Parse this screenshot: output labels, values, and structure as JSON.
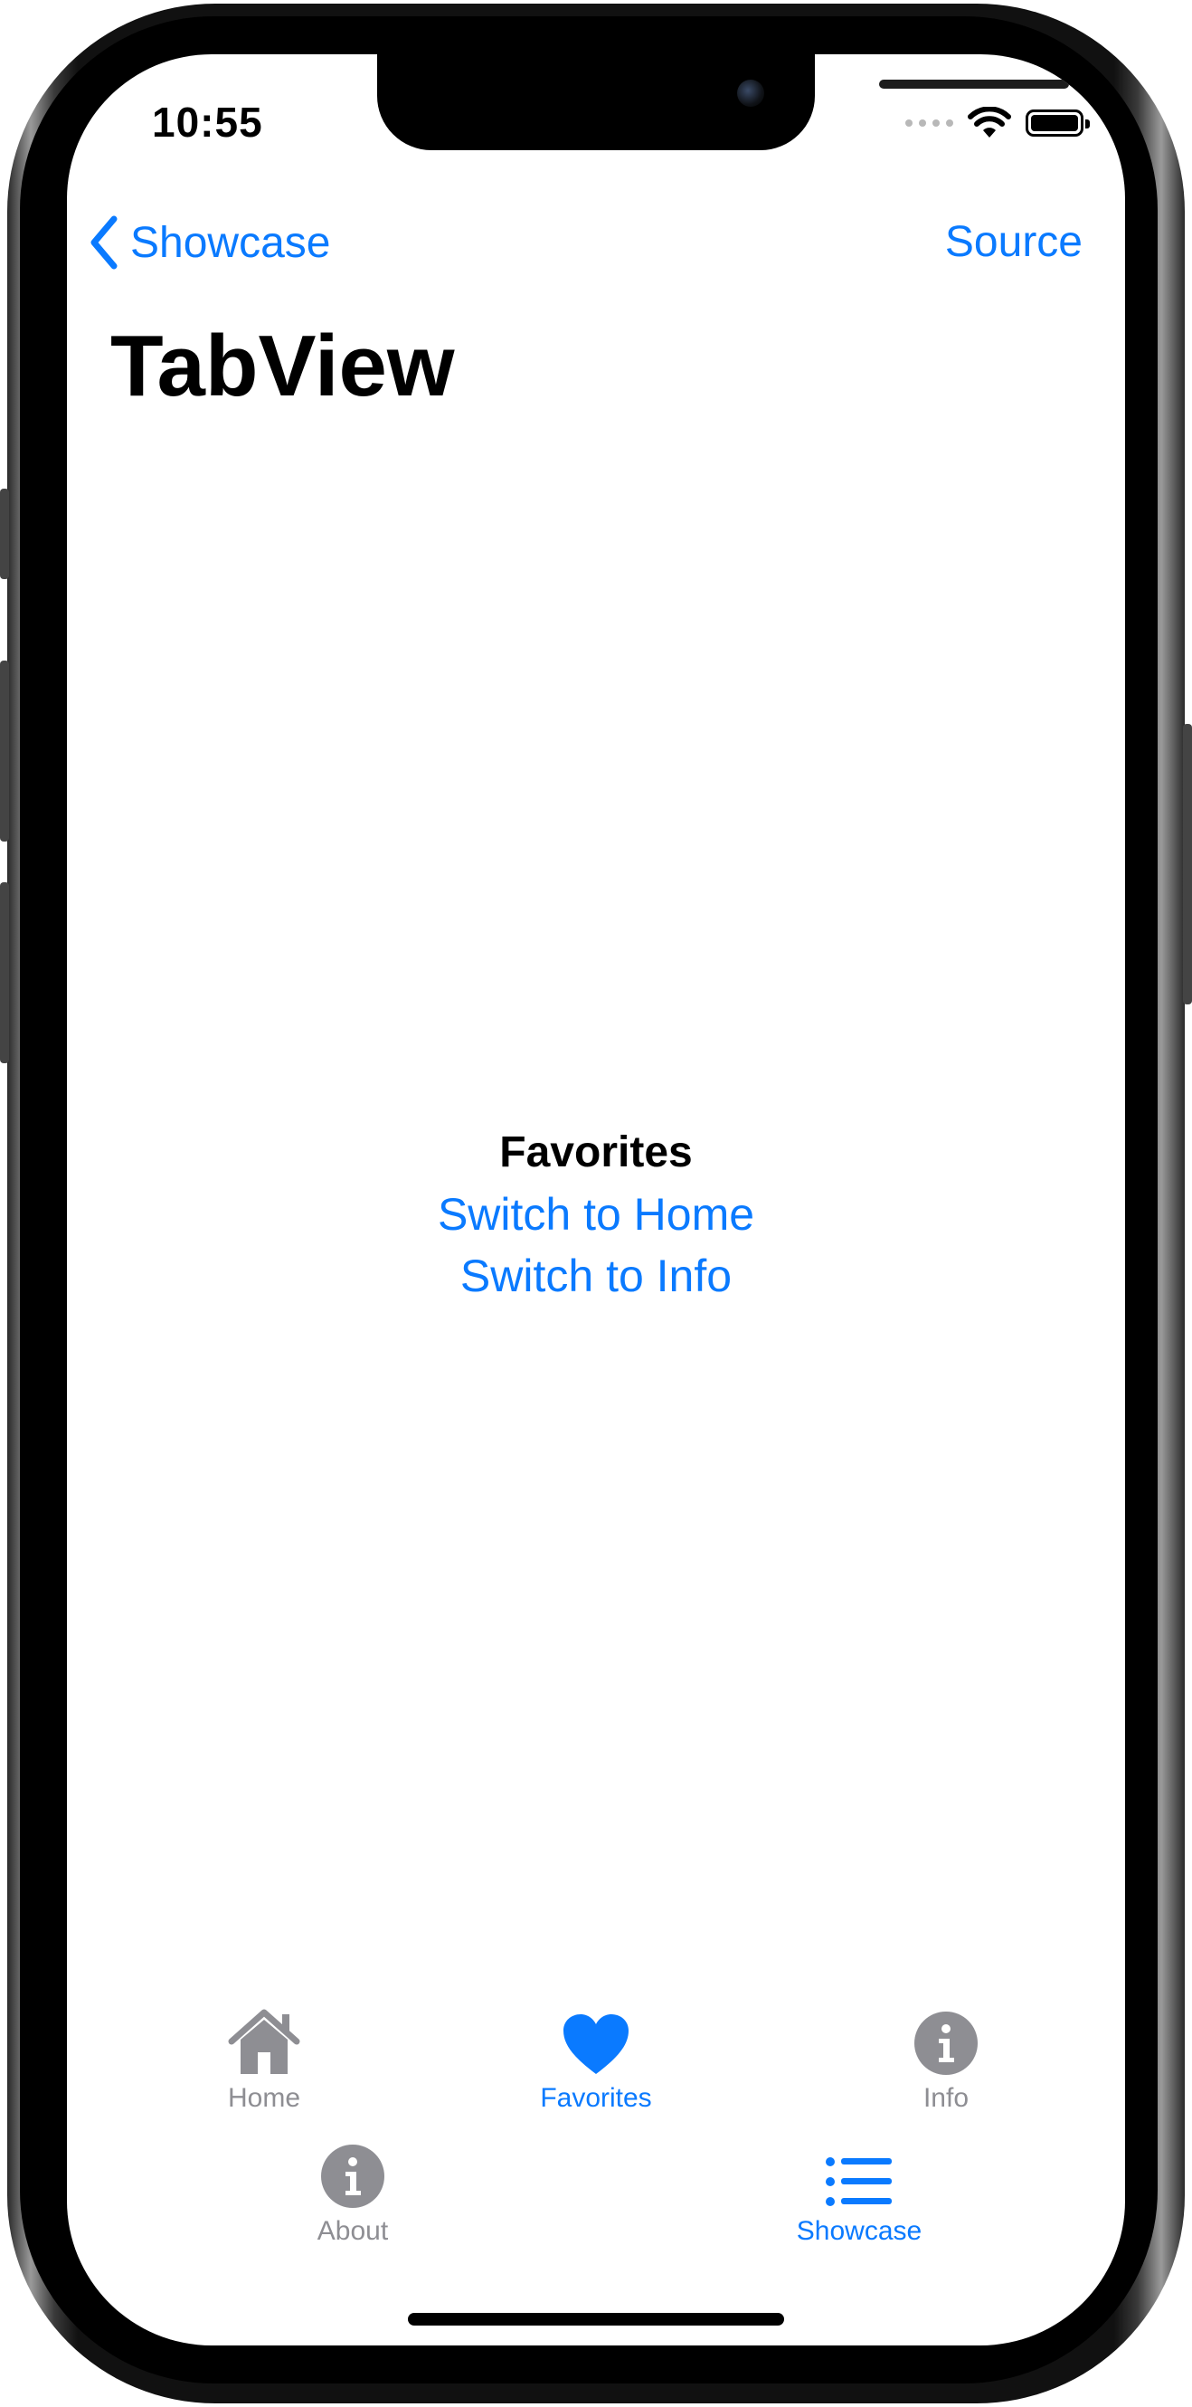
{
  "status_bar": {
    "time": "10:55"
  },
  "nav": {
    "back_label": "Showcase",
    "right_button": "Source",
    "title": "TabView"
  },
  "content": {
    "heading": "Favorites",
    "links": [
      "Switch to Home",
      "Switch to Info"
    ]
  },
  "tabs": [
    {
      "label": "Home",
      "icon": "house-icon",
      "active": false
    },
    {
      "label": "Favorites",
      "icon": "heart-icon",
      "active": true
    },
    {
      "label": "Info",
      "icon": "info-circle-icon",
      "active": false
    },
    {
      "label": "About",
      "icon": "info-circle-icon",
      "active": false
    },
    {
      "label": "Showcase",
      "icon": "list-icon",
      "active": true
    }
  ],
  "colors": {
    "accent": "#0a7aff",
    "inactive": "#8e8e93",
    "text": "#000000"
  }
}
